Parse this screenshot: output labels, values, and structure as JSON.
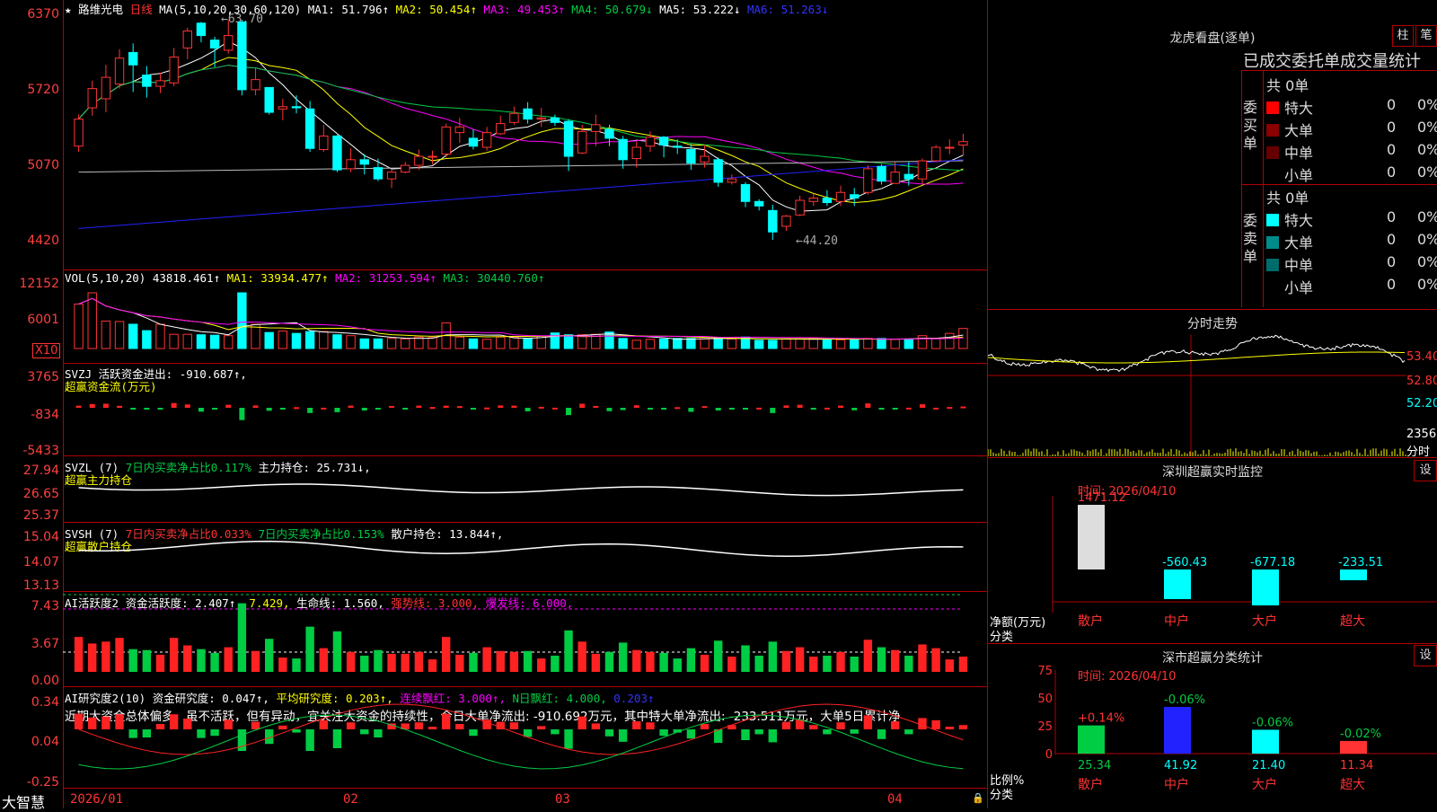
{
  "stock": {
    "star": "★",
    "name": "路维光电",
    "period": "日线"
  },
  "ma_header": {
    "label": "MA(5,10,20,30,60,120)",
    "ma1": "MA1: 51.796↑",
    "ma2": "MA2: 50.454↑",
    "ma3": "MA3: 49.453↑",
    "ma4": "MA4: 50.679↓",
    "ma5": "MA5: 53.222↓",
    "ma6": "MA6: 51.263↓"
  },
  "price_axis": [
    "6370",
    "5720",
    "5070",
    "4420"
  ],
  "price_marks": {
    "high": "←63.70",
    "low": "←44.20"
  },
  "vol_header": {
    "label": "VOL(5,10,20)",
    "value": "43818.461↑",
    "ma1": "MA1: 33934.477↑",
    "ma2": "MA2: 31253.594↑",
    "ma3": "MA3: 30440.760↑"
  },
  "vol_axis": [
    "12152",
    "6001"
  ],
  "vol_unit": "X10",
  "svzj": {
    "label": "SVZJ",
    "desc": "活跃资金进出: -910.687↑,",
    "sub": "超赢资金流(万元)",
    "axis": [
      "3765",
      "-834",
      "-5433"
    ]
  },
  "svzl": {
    "label": "SVZL (7)",
    "ratio": "7日内买卖净占比0.117%",
    "hold": "主力持仓: 25.731↓,",
    "sub": "超赢主力持仓",
    "axis": [
      "27.94",
      "26.65",
      "25.37"
    ]
  },
  "svsh": {
    "label": "SVSH (7)",
    "ratio1": "7日内买卖净占比0.033%",
    "ratio2": "7日内买卖净占比0.153%",
    "hold": "散户持仓: 13.844↑,",
    "sub": "超赢散户持仓",
    "axis": [
      "15.04",
      "14.07",
      "13.13"
    ]
  },
  "ai_active": {
    "label": "AI活跃度2",
    "v1": "资金活跃度: 2.407↑,",
    "v2": "7.429,",
    "v3": "生命线: 1.560,",
    "v4": "强势线: 3.000,",
    "v5": "爆发线: 6.000,",
    "axis": [
      "7.43",
      "3.67",
      "0.00"
    ]
  },
  "ai_research": {
    "label": "AI研究度2(10)",
    "v1": "资金研究度: 0.047↑,",
    "v2": "平均研究度: 0.203↑,",
    "v3": "连续飘红: 3.000↑,",
    "v4": "N日飘红: 4.000,",
    "v5": "0.203↑",
    "note": "近期大资金总体偏多，虽不活跃，但有异动，宜关注大资金的持续性，今日大单净流出: -910.692万元，其中特大单净流出: -233.511万元，大单5日累计净",
    "axis": [
      "0.34",
      "0.04",
      "-0.25"
    ]
  },
  "bottom": {
    "brand": "大智慧",
    "dates": [
      "2026/01",
      "02",
      "03",
      "04"
    ],
    "lock": "🔒"
  },
  "right": {
    "dragon_title": "龙虎看盘(逐单)",
    "btn_zhu": "柱",
    "btn_bi": "笔",
    "stat_title": "已成交委托单成交量统计",
    "buy": {
      "side": "委买单",
      "total": "共 0单",
      "rows": [
        {
          "label": "特大",
          "v": "0",
          "p": "0%",
          "color": "#ff0000"
        },
        {
          "label": "大单",
          "v": "0",
          "p": "0%",
          "color": "#8b0000"
        },
        {
          "label": "中单",
          "v": "0",
          "p": "0%",
          "color": "#660000"
        },
        {
          "label": "小单",
          "v": "0",
          "p": "0%",
          "color": ""
        }
      ]
    },
    "sell": {
      "side": "委卖单",
      "total": "共 0单",
      "rows": [
        {
          "label": "特大",
          "v": "0",
          "p": "0%",
          "color": "#00ffff"
        },
        {
          "label": "大单",
          "v": "0",
          "p": "0%",
          "color": "#008b8b"
        },
        {
          "label": "中单",
          "v": "0",
          "p": "0%",
          "color": "#006b6b"
        },
        {
          "label": "小单",
          "v": "0",
          "p": "0%",
          "color": ""
        }
      ]
    },
    "intraday": {
      "title": "分时走势",
      "axis": [
        "53.40",
        "52.80",
        "52.20"
      ],
      "vol": "2356",
      "vol_unit": "分时"
    },
    "monitor": {
      "title": "深圳超赢实时监控",
      "btn": "设",
      "time": "时间: 2026/04/10",
      "axis": [
        "1471.12",
        "755.02",
        "38.90",
        "-677.18"
      ],
      "top": "1471.12",
      "vals": [
        "-560.43",
        "-677.18",
        "-233.51"
      ],
      "ylabel": "净额(万元)",
      "xlabel": "分类",
      "cats": [
        "散户",
        "中户",
        "大户",
        "超大"
      ]
    },
    "classify": {
      "title": "深市超赢分类统计",
      "btn": "设",
      "time": "时间: 2026/04/10",
      "axis": [
        "75",
        "50",
        "25",
        "0"
      ],
      "ylabel": "比例%",
      "xlabel": "分类",
      "deltas": [
        "+0.14%",
        "-0.06%",
        "-0.06%",
        "-0.02%"
      ],
      "values": [
        "25.34",
        "41.92",
        "21.40",
        "11.34"
      ],
      "cats": [
        "散户",
        "中户",
        "大户",
        "超大"
      ]
    }
  },
  "chart_data": {
    "type": "candlestick",
    "candles": [
      [
        52.5,
        54.9,
        52.0,
        55.3
      ],
      [
        55.9,
        57.6,
        55.2,
        58.3
      ],
      [
        56.7,
        58.6,
        55.5,
        59.7
      ],
      [
        58.0,
        60.3,
        57.6,
        61.1
      ],
      [
        60.8,
        59.7,
        57.3,
        61.6
      ],
      [
        58.8,
        57.8,
        56.8,
        59.6
      ],
      [
        57.8,
        58.3,
        57.2,
        59.0
      ],
      [
        58.1,
        60.4,
        57.8,
        61.2
      ],
      [
        61.2,
        62.7,
        60.2,
        63.0
      ],
      [
        63.4,
        62.3,
        61.7,
        63.5
      ],
      [
        61.9,
        61.2,
        59.5,
        62.2
      ],
      [
        61.0,
        62.3,
        60.7,
        63.7
      ],
      [
        63.5,
        57.5,
        57.0,
        63.7
      ],
      [
        57.5,
        58.4,
        57.0,
        59.4
      ],
      [
        57.7,
        55.5,
        55.3,
        57.7
      ],
      [
        55.8,
        56.0,
        54.8,
        56.7
      ],
      [
        56.0,
        55.9,
        55.4,
        57.0
      ],
      [
        55.8,
        52.3,
        52.0,
        56.5
      ],
      [
        52.2,
        53.4,
        52.0,
        54.4
      ],
      [
        53.4,
        50.4,
        50.2,
        53.5
      ],
      [
        50.5,
        51.3,
        50.2,
        52.3
      ],
      [
        51.3,
        50.9,
        50.0,
        51.8
      ],
      [
        50.6,
        49.6,
        49.4,
        51.4
      ],
      [
        49.6,
        50.2,
        48.8,
        50.4
      ],
      [
        50.2,
        50.8,
        50.1,
        51.1
      ],
      [
        50.8,
        51.6,
        50.4,
        52.2
      ],
      [
        51.6,
        51.6,
        50.9,
        52.1
      ],
      [
        51.8,
        54.2,
        51.5,
        54.5
      ],
      [
        53.7,
        54.2,
        52.8,
        55.0
      ],
      [
        53.2,
        52.5,
        52.2,
        54.0
      ],
      [
        52.4,
        53.7,
        52.1,
        54.2
      ],
      [
        53.6,
        54.5,
        53.5,
        55.2
      ],
      [
        54.6,
        55.4,
        54.4,
        56.0
      ],
      [
        55.8,
        54.9,
        54.5,
        56.4
      ],
      [
        54.9,
        55.0,
        54.2,
        55.9
      ],
      [
        55.0,
        54.6,
        54.3,
        55.3
      ],
      [
        54.7,
        51.6,
        50.3,
        54.9
      ],
      [
        51.9,
        53.8,
        51.8,
        54.4
      ],
      [
        53.8,
        54.4,
        52.5,
        55.3
      ],
      [
        54.0,
        53.2,
        52.5,
        54.4
      ],
      [
        53.1,
        51.3,
        50.5,
        53.4
      ],
      [
        51.4,
        52.4,
        50.6,
        52.9
      ],
      [
        52.5,
        53.3,
        52.0,
        53.8
      ],
      [
        53.3,
        52.6,
        51.5,
        53.4
      ],
      [
        52.5,
        52.4,
        51.8,
        53.1
      ],
      [
        52.2,
        51.0,
        50.4,
        52.7
      ],
      [
        51.1,
        51.6,
        50.6,
        52.6
      ],
      [
        51.3,
        49.3,
        48.9,
        51.5
      ],
      [
        49.3,
        49.6,
        49.1,
        50.0
      ],
      [
        49.1,
        47.6,
        47.1,
        49.3
      ],
      [
        47.6,
        47.2,
        46.8,
        47.8
      ],
      [
        46.8,
        44.9,
        44.2,
        47.3
      ],
      [
        45.4,
        46.3,
        45.0,
        46.4
      ],
      [
        46.4,
        47.7,
        46.3,
        48.1
      ],
      [
        47.6,
        47.9,
        47.2,
        48.3
      ],
      [
        47.9,
        47.5,
        47.2,
        48.6
      ],
      [
        47.6,
        48.4,
        47.2,
        49.0
      ],
      [
        48.2,
        47.9,
        47.2,
        48.8
      ],
      [
        48.4,
        50.5,
        48.2,
        50.8
      ],
      [
        50.7,
        49.4,
        49.1,
        50.9
      ],
      [
        49.2,
        50.2,
        49.2,
        51.1
      ],
      [
        50.0,
        49.6,
        49.0,
        51.1
      ],
      [
        49.6,
        51.2,
        49.1,
        51.4
      ],
      [
        51.2,
        52.4,
        51.1,
        52.6
      ],
      [
        52.4,
        52.4,
        51.8,
        53.1
      ],
      [
        52.6,
        52.9,
        51.7,
        53.6
      ]
    ],
    "volume": [
      9700,
      12152,
      6000,
      5900,
      5300,
      3900,
      5300,
      3100,
      3100,
      3000,
      2900,
      2800,
      12152,
      5300,
      3500,
      3800,
      3300,
      3700,
      3700,
      3000,
      2800,
      2100,
      2100,
      2200,
      2100,
      2500,
      2400,
      5600,
      2500,
      2100,
      2000,
      2500,
      2500,
      2200,
      2700,
      3400,
      3000,
      3000,
      3100,
      3600,
      2200,
      1800,
      2000,
      2100,
      2200,
      2200,
      2100,
      2300,
      2100,
      2500,
      1800,
      1800,
      2100,
      2100,
      2300,
      2000,
      1900,
      1900,
      2200,
      2200,
      2000,
      2100,
      2800,
      2100,
      3300,
      4381
    ],
    "ylim": [
      44.2,
      63.7
    ]
  }
}
